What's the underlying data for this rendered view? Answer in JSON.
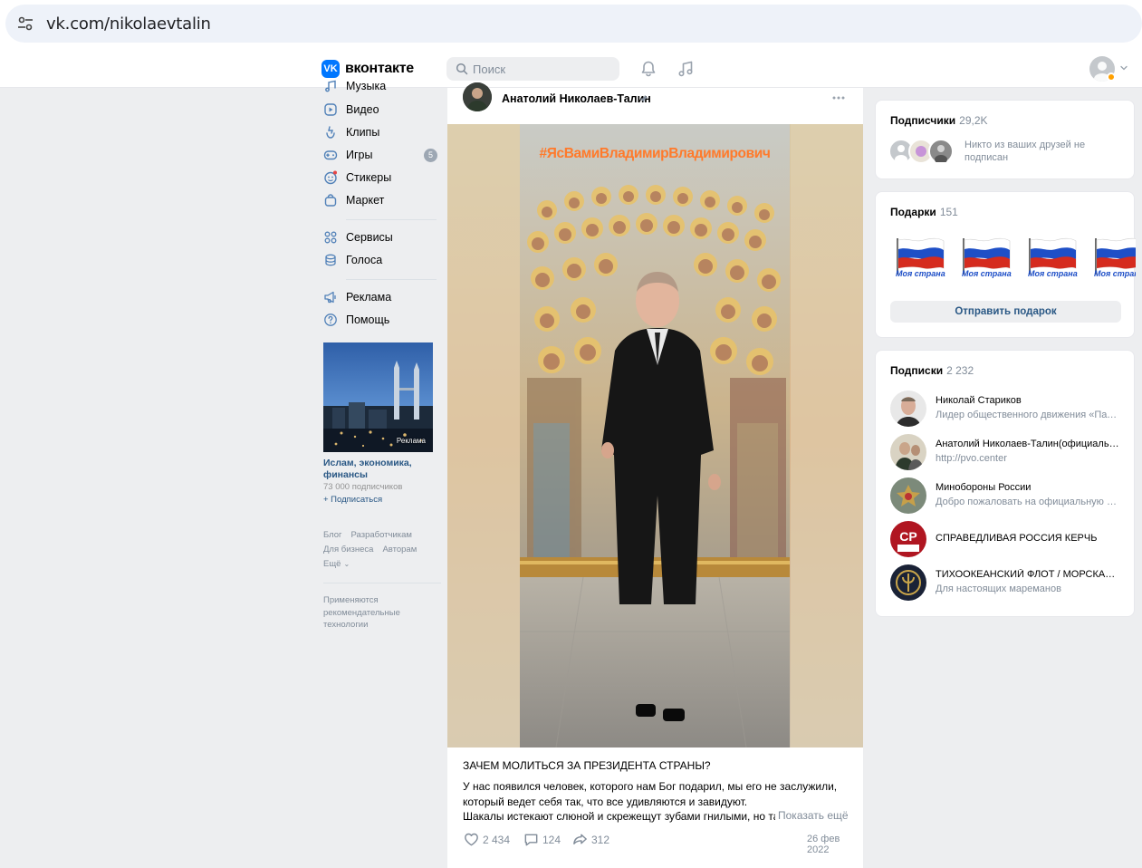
{
  "browser": {
    "url": "vk.com/nikolaevtalin"
  },
  "header": {
    "logo_text": "вконтакте",
    "logo_mark": "VK",
    "search_placeholder": "Поиск",
    "icons": [
      "search-icon",
      "bell-icon",
      "music-icon",
      "avatar",
      "chevron-down-icon"
    ]
  },
  "left_nav": {
    "items": [
      {
        "label": "Музыка",
        "icon": "music-icon"
      },
      {
        "label": "Видео",
        "icon": "video-icon"
      },
      {
        "label": "Клипы",
        "icon": "clips-icon"
      },
      {
        "label": "Игры",
        "icon": "gamepad-icon",
        "badge": "5"
      },
      {
        "label": "Стикеры",
        "icon": "sticker-icon"
      },
      {
        "label": "Маркет",
        "icon": "bag-icon"
      },
      {
        "label": "Сервисы",
        "icon": "grid-icon"
      },
      {
        "label": "Голоса",
        "icon": "coins-icon"
      },
      {
        "label": "Реклама",
        "icon": "megaphone-icon"
      },
      {
        "label": "Помощь",
        "icon": "help-icon"
      }
    ],
    "ad": {
      "tag": "Реклама",
      "title": "Ислам, экономика, финансы",
      "subscribers": "73 000 подписчиков",
      "join": "+ Подписаться"
    },
    "footer_links": [
      "Блог",
      "Разработчикам",
      "Для бизнеса",
      "Авторам",
      "Ещё"
    ],
    "footer_note": "Применяются рекомендательные технологии"
  },
  "post": {
    "author": "Анатолий Николаев-Талин",
    "image_caption": "#ЯсВамиВладимирВладимирович",
    "title": "ЗАЧЕМ МОЛИТЬСЯ ЗА ПРЕЗИДЕНТА СТРАНЫ?",
    "text_line1": "У нас появился человек, которого нам Бог подарил, мы его не заслужили,",
    "text_line2": "который ведет себя так, что все удивляются и завидуют.",
    "text_line3": "Шакалы истекают слюной и скрежещут зубами гнилыми, но так",
    "show_more": "Показать ещё",
    "likes": "2 434",
    "comments": "124",
    "shares": "312",
    "date": "26 фев 2022"
  },
  "subscribers_card": {
    "title": "Подписчики",
    "count": "29,2K",
    "note": "Никто из ваших друзей не подписан"
  },
  "gifts_card": {
    "title": "Подарки",
    "count": "151",
    "gift_label": "Моя страна",
    "button": "Отправить подарок"
  },
  "follows_card": {
    "title": "Подписки",
    "count": "2 232",
    "items": [
      {
        "name": "Николай Стариков",
        "desc": "Лидер общественного движения «Патриотические силы»"
      },
      {
        "name": "Анатолий Николаев-Талин(официальный)",
        "desc": "http://pvo.center"
      },
      {
        "name": "Минобороны России",
        "desc": "Добро пожаловать на официальную страницу"
      },
      {
        "name": "СПРАВЕДЛИВАЯ РОССИЯ КЕРЧЬ",
        "desc": ""
      },
      {
        "name": "ТИХООКЕАНСКИЙ ФЛОТ / МОРСКАЯ ПЕХОТА",
        "desc": "Для настоящих мареманов"
      }
    ]
  },
  "colors": {
    "vk_blue": "#0077ff",
    "link": "#2a5885",
    "muted": "#818c99",
    "page_bg": "#edeef0",
    "hashtag_orange": "#ff7a2b"
  }
}
